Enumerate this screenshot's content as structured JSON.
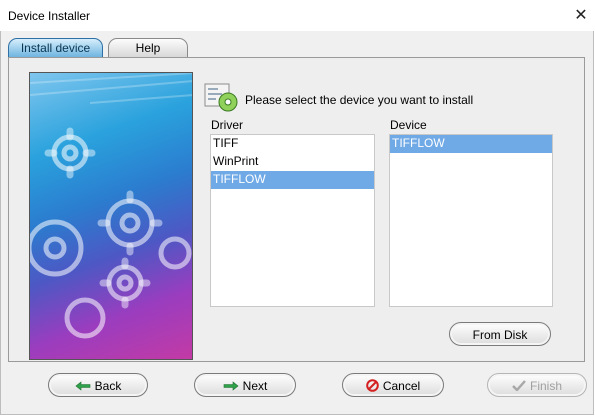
{
  "window": {
    "title": "Device Installer",
    "close_glyph": "✕"
  },
  "tabs": [
    {
      "label": "Install device",
      "active": true
    },
    {
      "label": "Help",
      "active": false
    }
  ],
  "header": {
    "icon": "install-disc-icon",
    "text": "Please select the device you want to install"
  },
  "driver": {
    "label": "Driver",
    "items": [
      "TIFF",
      "WinPrint",
      "TIFFLOW"
    ],
    "selected": "TIFFLOW"
  },
  "device": {
    "label": "Device",
    "items": [
      "TIFFLOW"
    ],
    "selected": "TIFFLOW"
  },
  "buttons": {
    "from_disk": "From Disk",
    "back": "Back",
    "next": "Next",
    "cancel": "Cancel",
    "finish": "Finish"
  },
  "colors": {
    "selection": "#6fa9e6",
    "active_tab": "#6fb4e0",
    "cancel_icon": "#d42020",
    "arrow_icon": "#2fa14a"
  }
}
